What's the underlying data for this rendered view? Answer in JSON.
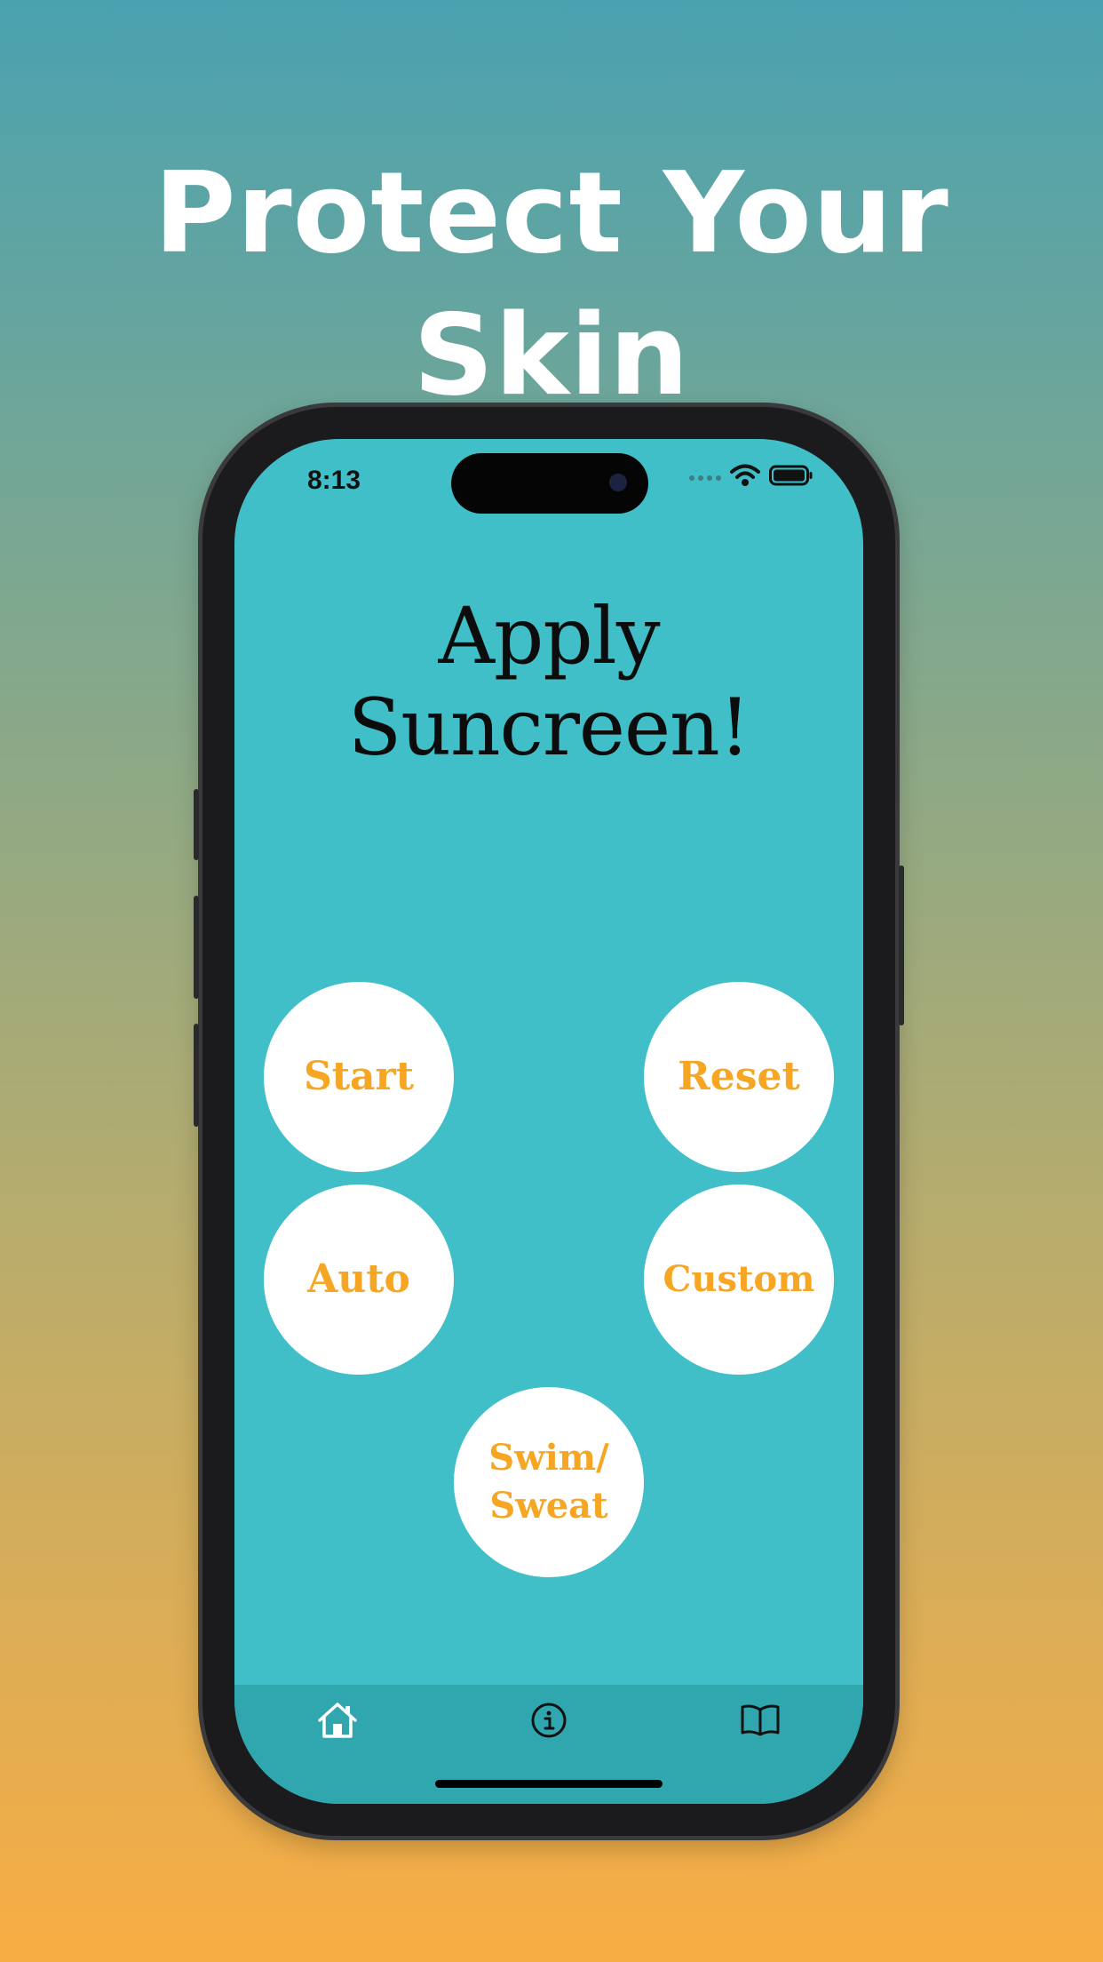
{
  "headline": "Protect Your Skin",
  "status_bar": {
    "time": "8:13"
  },
  "screen": {
    "title": "Apply Suncreen!"
  },
  "buttons": {
    "start": "Start",
    "reset": "Reset",
    "auto": "Auto",
    "custom": "Custom",
    "swim_sweat": "Swim/\nSweat"
  },
  "tabbar": {
    "tabs": [
      {
        "icon": "home-icon"
      },
      {
        "icon": "info-icon"
      },
      {
        "icon": "book-icon"
      }
    ]
  },
  "colors": {
    "screen_background": "#40bfc8",
    "tabbar_background": "#30a6ae",
    "button_text": "#f6a623",
    "button_fill": "#ffffff"
  }
}
